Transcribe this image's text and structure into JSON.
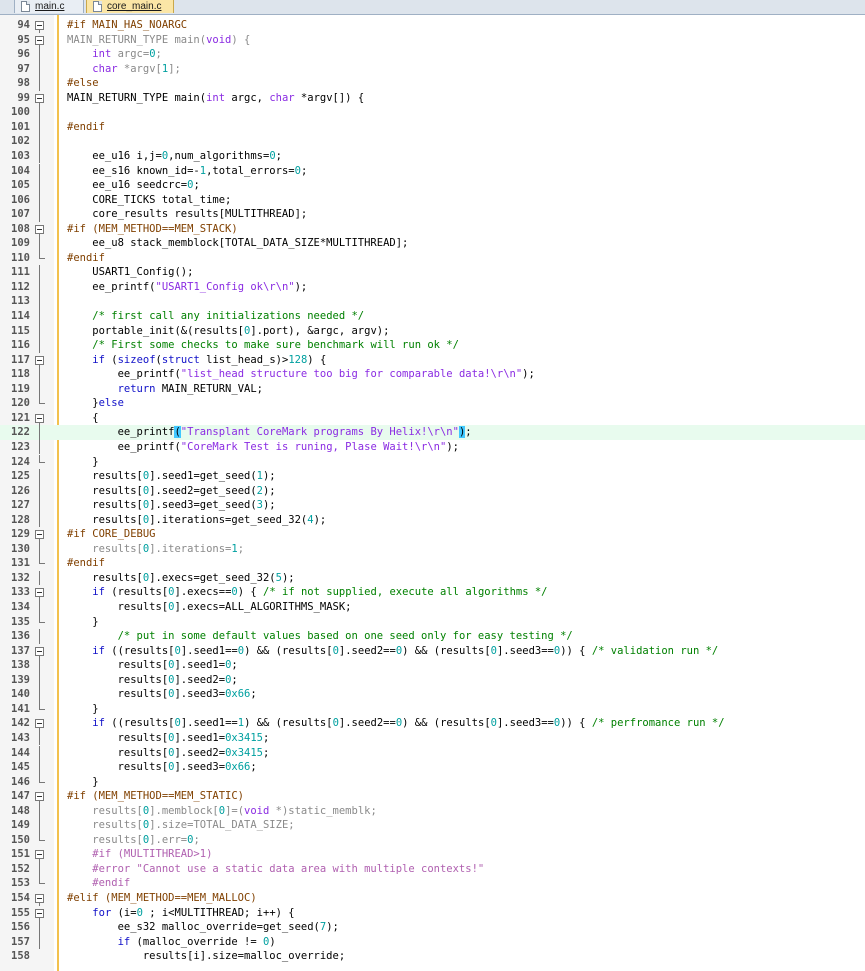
{
  "tabs": [
    {
      "label": "main.c",
      "active": false
    },
    {
      "label": "core_main.c",
      "active": true
    }
  ],
  "colors": {
    "accent": "#f2c14e",
    "keyword": "#1010c8",
    "string": "#8a2be2",
    "comment": "#008000",
    "number": "#00a0a0",
    "current_line": "#e8fbee"
  },
  "lines": [
    {
      "n": "94",
      "text": "#if MAIN_HAS_NOARGC"
    },
    {
      "n": "95",
      "text": "MAIN_RETURN_TYPE main(void) {"
    },
    {
      "n": "96",
      "text": "    int argc=0;"
    },
    {
      "n": "97",
      "text": "    char *argv[1];"
    },
    {
      "n": "98",
      "text": "#else"
    },
    {
      "n": "99",
      "text": "MAIN_RETURN_TYPE main(int argc, char *argv[]) {"
    },
    {
      "n": "100",
      "text": ""
    },
    {
      "n": "101",
      "text": "#endif"
    },
    {
      "n": "102",
      "text": ""
    },
    {
      "n": "103",
      "text": "    ee_u16 i,j=0,num_algorithms=0;"
    },
    {
      "n": "104",
      "text": "    ee_s16 known_id=-1,total_errors=0;"
    },
    {
      "n": "105",
      "text": "    ee_u16 seedcrc=0;"
    },
    {
      "n": "106",
      "text": "    CORE_TICKS total_time;"
    },
    {
      "n": "107",
      "text": "    core_results results[MULTITHREAD];"
    },
    {
      "n": "108",
      "text": "#if (MEM_METHOD==MEM_STACK)"
    },
    {
      "n": "109",
      "text": "    ee_u8 stack_memblock[TOTAL_DATA_SIZE*MULTITHREAD];"
    },
    {
      "n": "110",
      "text": "#endif"
    },
    {
      "n": "111",
      "text": "    USART1_Config();"
    },
    {
      "n": "112",
      "text": "    ee_printf(\"USART1_Config ok\\r\\n\");"
    },
    {
      "n": "113",
      "text": ""
    },
    {
      "n": "114",
      "text": "    /* first call any initializations needed */"
    },
    {
      "n": "115",
      "text": "    portable_init(&(results[0].port), &argc, argv);"
    },
    {
      "n": "116",
      "text": "    /* First some checks to make sure benchmark will run ok */"
    },
    {
      "n": "117",
      "text": "    if (sizeof(struct list_head_s)>128) {"
    },
    {
      "n": "118",
      "text": "        ee_printf(\"list_head structure too big for comparable data!\\r\\n\");"
    },
    {
      "n": "119",
      "text": "        return MAIN_RETURN_VAL;"
    },
    {
      "n": "120",
      "text": "    }else"
    },
    {
      "n": "121",
      "text": "    {"
    },
    {
      "n": "122",
      "text": "        ee_printf(\"Transplant CoreMark programs By Helix!\\r\\n\");"
    },
    {
      "n": "123",
      "text": "        ee_printf(\"CoreMark Test is runing, Plase Wait!\\r\\n\");"
    },
    {
      "n": "124",
      "text": "    }"
    },
    {
      "n": "125",
      "text": "    results[0].seed1=get_seed(1);"
    },
    {
      "n": "126",
      "text": "    results[0].seed2=get_seed(2);"
    },
    {
      "n": "127",
      "text": "    results[0].seed3=get_seed(3);"
    },
    {
      "n": "128",
      "text": "    results[0].iterations=get_seed_32(4);"
    },
    {
      "n": "129",
      "text": "#if CORE_DEBUG"
    },
    {
      "n": "130",
      "text": "    results[0].iterations=1;"
    },
    {
      "n": "131",
      "text": "#endif"
    },
    {
      "n": "132",
      "text": "    results[0].execs=get_seed_32(5);"
    },
    {
      "n": "133",
      "text": "    if (results[0].execs==0) { /* if not supplied, execute all algorithms */"
    },
    {
      "n": "134",
      "text": "        results[0].execs=ALL_ALGORITHMS_MASK;"
    },
    {
      "n": "135",
      "text": "    }"
    },
    {
      "n": "136",
      "text": "        /* put in some default values based on one seed only for easy testing */"
    },
    {
      "n": "137",
      "text": "    if ((results[0].seed1==0) && (results[0].seed2==0) && (results[0].seed3==0)) { /* validation run */"
    },
    {
      "n": "138",
      "text": "        results[0].seed1=0;"
    },
    {
      "n": "139",
      "text": "        results[0].seed2=0;"
    },
    {
      "n": "140",
      "text": "        results[0].seed3=0x66;"
    },
    {
      "n": "141",
      "text": "    }"
    },
    {
      "n": "142",
      "text": "    if ((results[0].seed1==1) && (results[0].seed2==0) && (results[0].seed3==0)) { /* perfromance run */"
    },
    {
      "n": "143",
      "text": "        results[0].seed1=0x3415;"
    },
    {
      "n": "144",
      "text": "        results[0].seed2=0x3415;"
    },
    {
      "n": "145",
      "text": "        results[0].seed3=0x66;"
    },
    {
      "n": "146",
      "text": "    }"
    },
    {
      "n": "147",
      "text": "#if (MEM_METHOD==MEM_STATIC)"
    },
    {
      "n": "148",
      "text": "    results[0].memblock[0]=(void *)static_memblk;"
    },
    {
      "n": "149",
      "text": "    results[0].size=TOTAL_DATA_SIZE;"
    },
    {
      "n": "150",
      "text": "    results[0].err=0;"
    },
    {
      "n": "151",
      "text": "    #if (MULTITHREAD>1)"
    },
    {
      "n": "152",
      "text": "    #error \"Cannot use a static data area with multiple contexts!\""
    },
    {
      "n": "153",
      "text": "    #endif"
    },
    {
      "n": "154",
      "text": "#elif (MEM_METHOD==MEM_MALLOC)"
    },
    {
      "n": "155",
      "text": "    for (i=0 ; i<MULTITHREAD; i++) {"
    },
    {
      "n": "156",
      "text": "        ee_s32 malloc_override=get_seed(7);"
    },
    {
      "n": "157",
      "text": "        if (malloc_override != 0)"
    },
    {
      "n": "158",
      "text": "            results[i].size=malloc_override;"
    }
  ]
}
